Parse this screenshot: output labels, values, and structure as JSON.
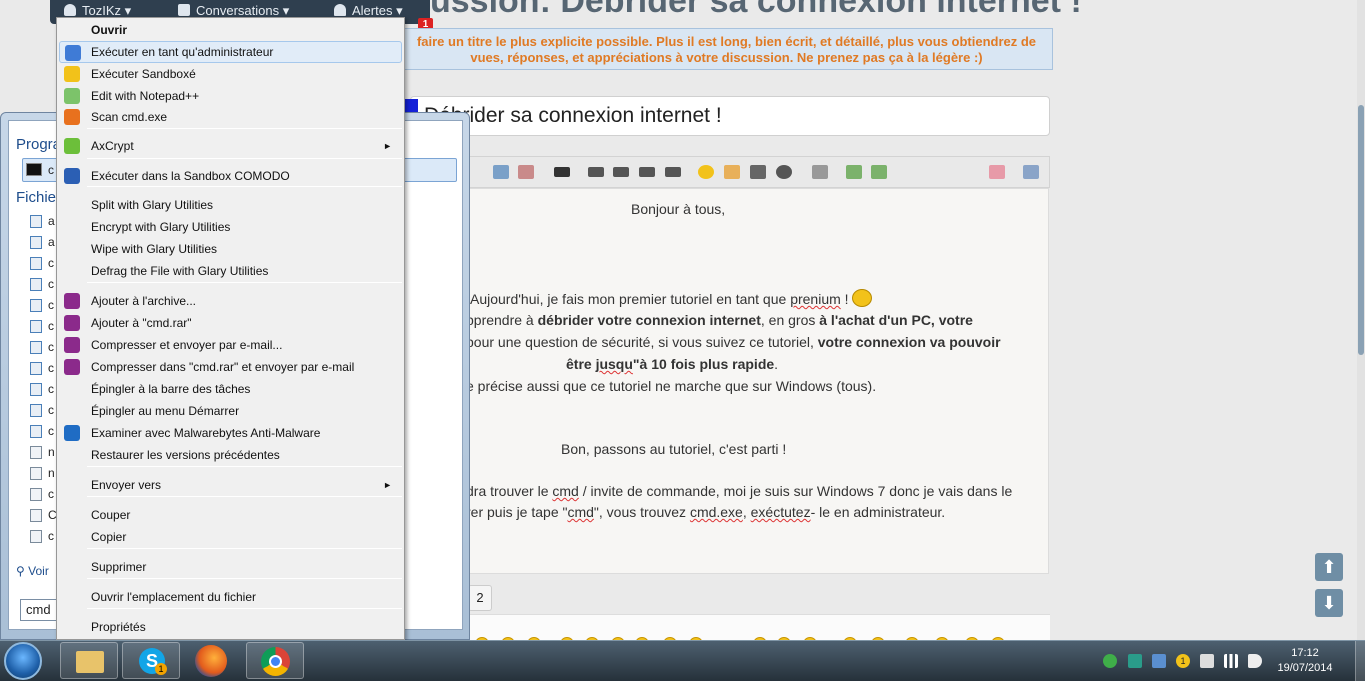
{
  "forum": {
    "user": "TozIKz",
    "nav_conversations": "Conversations",
    "nav_alerts": "Alertes",
    "notif_count": "1",
    "heading": "ussion: Débrider sa connexion internet !",
    "hint": "faire un titre le plus explicite possible. Plus il est long, bien écrit, et détaillé, plus vous obtiendrez de vues, réponses, et appréciations à votre discussion. Ne prenez pas ça à la légère :)",
    "title_value": "Débrider sa connexion internet !",
    "page_button": "2"
  },
  "post": {
    "l1": "Bonjour à tous,",
    "l2a": "Aujourd'hui, je fais mon premier tutoriel en tant que ",
    "l2b": "prenium",
    "l2c": " !",
    "l3a": "pprendre à ",
    "l3b": "débrider votre connexion internet",
    "l3c": ", en gros ",
    "l3d": "à l'achat d'un PC, votre",
    "l4a": "pour une question de sécurité, si vous suivez ce tutoriel, ",
    "l4b": "votre connexion va pouvoir",
    "l5a": "être ",
    "l5b": "jusqu",
    "l5c": "\"à 10 fois plus rapide",
    "l5d": ".",
    "l6": "e précise aussi que ce tutoriel ne marche que sur Windows (tous).",
    "l7": "Bon, passons au tutoriel, c'est parti !",
    "l8a": "dra trouver le ",
    "l8b": "cmd",
    "l8c": " / invite de commande, moi je suis sur Windows 7 donc je vais dans le",
    "l9a": "rer puis je tape \"",
    "l9b": "cmd",
    "l9c": "\", vous trouvez ",
    "l9d": "cmd.exe",
    "l9e": ", ",
    "l9f": "exéctutez",
    "l9g": "- le en administrateur."
  },
  "startmenu": {
    "header_programs": "Progra",
    "header_files": "Fichie",
    "program_item": "c",
    "file_items": [
      "a",
      "a",
      "c",
      "c",
      "c",
      "c",
      "c",
      "c",
      "c",
      "c",
      "c",
      "n",
      "n",
      "c",
      "C",
      "c"
    ],
    "see_more": "Voir",
    "search_value": "cmd"
  },
  "context_menu": {
    "items": [
      "Ouvrir",
      "Exécuter en tant qu'administrateur",
      "Exécuter Sandboxé",
      "Edit with Notepad++",
      "Scan cmd.exe",
      "AxCrypt",
      "Exécuter dans la Sandbox COMODO",
      "Split with Glary Utilities",
      "Encrypt with Glary Utilities",
      "Wipe with Glary Utilities",
      "Defrag the File with Glary Utilities",
      "Ajouter à l'archive...",
      "Ajouter à \"cmd.rar\"",
      "Compresser et envoyer par e-mail...",
      "Compresser dans \"cmd.rar\" et envoyer par e-mail",
      "Épingler à la barre des tâches",
      "Épingler au menu Démarrer",
      "Examiner avec Malwarebytes Anti-Malware",
      "Restaurer les versions précédentes",
      "Envoyer vers",
      "Couper",
      "Copier",
      "Supprimer",
      "Ouvrir l'emplacement du fichier",
      "Propriétés"
    ],
    "submenu_arrow": "►"
  },
  "taskbar": {
    "time": "17:12",
    "date": "19/07/2014",
    "skype_badge": "1",
    "tray_badge": "1"
  },
  "icons": {
    "up_arrow": "⬆",
    "down_arrow": "⬇",
    "chevron": "▾"
  }
}
